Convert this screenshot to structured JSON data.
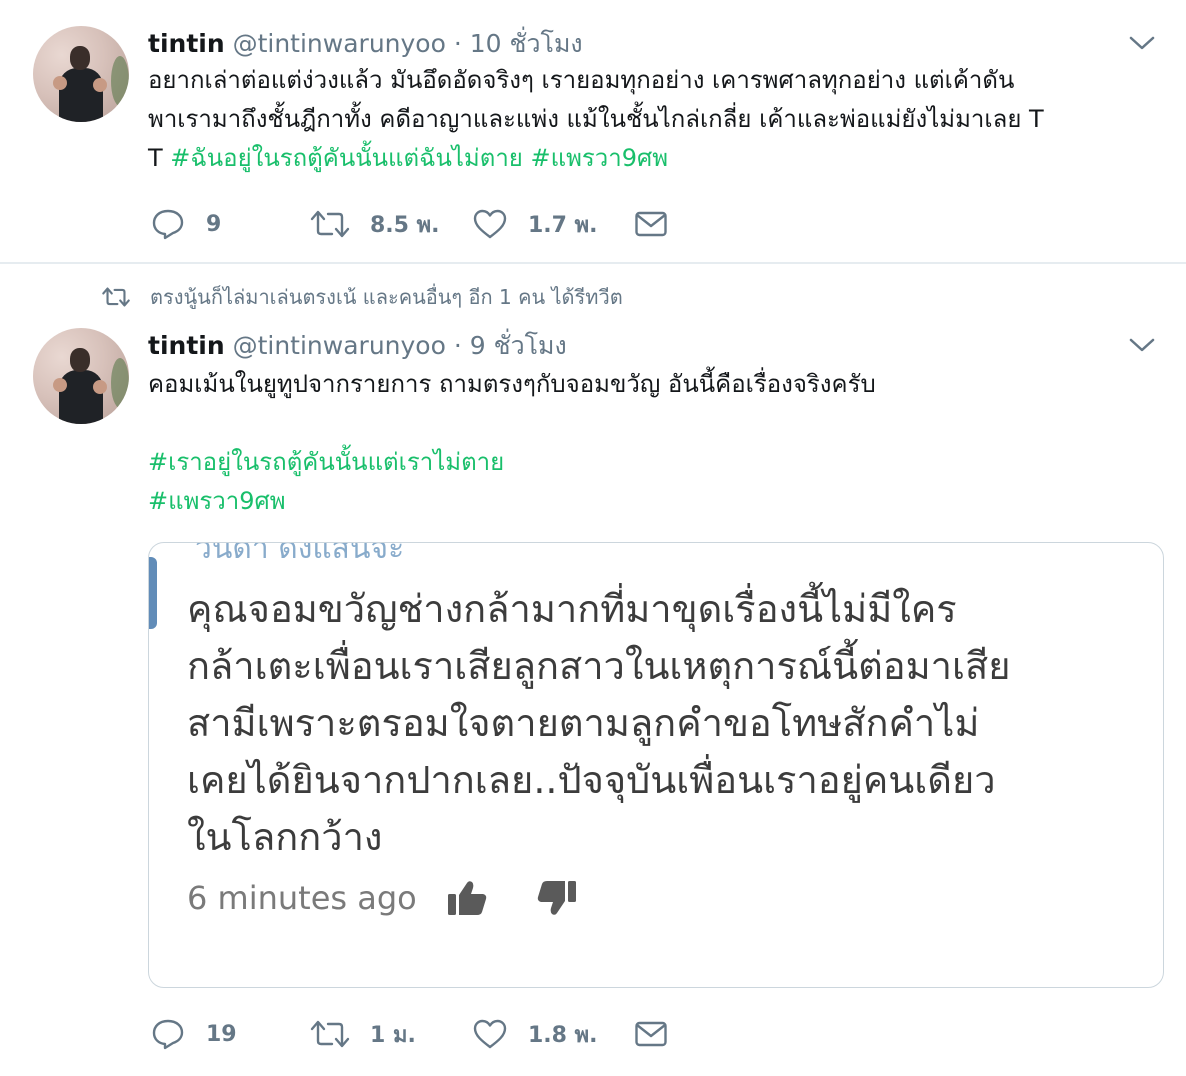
{
  "tweets": [
    {
      "name": "tintin",
      "handle": "@tintinwarunyoo",
      "separator": "·",
      "time": "10 ชั่วโมง",
      "text_lines": [
        "อยากเล่าต่อแต่ง่วงแล้ว  มันอึดอัดจริงๆ  เรายอมทุกอย่าง  เคารพศาลทุกอย่าง  แต่เค้าดัน",
        "พาเรามาถึงชั้นฎีกาทั้ง คดีอาญาและแพ่ง  แม้ในชั้นไกล่เกลี่ย เค้าและพ่อแม่ยังไม่มาเลย T"
      ],
      "line3_prefix": "T ",
      "hashtag1": "#ฉันอยู่ในรถตู้คันนั้นแต่ฉันไม่ตาย",
      "hashtag2": "#แพรวา9ศพ",
      "replies": "9",
      "retweets": "8.5 พ.",
      "likes": "1.7 พ."
    },
    {
      "retweet_context": "ตรงนู้นก็ไล่มาเล่นตรงเน้ และคนอื่นๆ อีก 1 คน ได้รีทวีต",
      "name": "tintin",
      "handle": "@tintinwarunyoo",
      "separator": "·",
      "time": "9 ชั่วโมง",
      "text": "คอมเม้นในยูทูปจากรายการ ถามตรงๆกับจอมขวัญ อันนี้คือเรื่องจริงครับ",
      "hashtag1": "#เราอยู่ในรถตู้คันนั้นแต่เราไม่ตาย",
      "hashtag2": "#แพรวา9ศพ",
      "replies": "19",
      "retweets": "1 ม.",
      "likes": "1.8 พ.",
      "card": {
        "cutoff_text": "วันดา ดังแสนจะ",
        "comment_lines": [
          "คุณจอมขวัญช่างกล้ามากที่มาขุดเรื่องนี้ไม่มีใคร",
          "กล้าเตะเพื่อนเราเสียลูกสาวในเหตุการณ์นี้ต่อมาเสีย",
          "สามีเพราะตรอมใจตายตามลูกคำขอโทษสักคำไม่",
          "เคยได้ยินจากปากเลย..ปัจจุบันเพื่อนเราอยู่คนเดียว",
          "ในโลกกว้าง"
        ],
        "time_ago": "6 minutes ago"
      }
    }
  ],
  "colors": {
    "hashtag": "#19bf6b",
    "meta_gray": "#657786",
    "icon_gray": "#657786",
    "border": "#e6ecf0"
  },
  "icons": [
    "chevron-down-icon",
    "reply-icon",
    "retweet-icon",
    "like-icon",
    "dm-icon",
    "thumbs-up-icon",
    "thumbs-down-icon"
  ]
}
